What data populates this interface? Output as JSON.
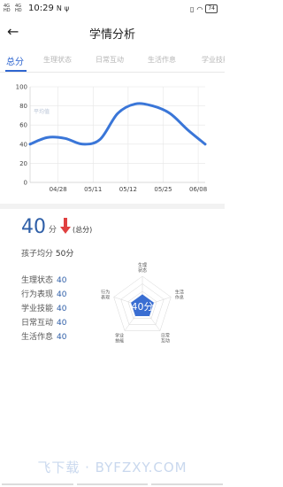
{
  "status_bar": {
    "signal_1": "4G HD",
    "signal_2": "4G HD",
    "time": "10:29",
    "app_icon": "N",
    "usb_icon": "usb-icon",
    "right_icons": [
      "vibrate-icon",
      "wifi-icon",
      "battery-icon"
    ],
    "battery": "74"
  },
  "header": {
    "back_icon": "arrow-left-icon",
    "title": "学情分析"
  },
  "tabs": [
    {
      "label": "总分",
      "active": true
    },
    {
      "label": "生理状态",
      "active": false
    },
    {
      "label": "日常互动",
      "active": false
    },
    {
      "label": "生活作息",
      "active": false
    },
    {
      "label": "学业技能",
      "active": false
    }
  ],
  "chart_data": {
    "type": "line",
    "title": "",
    "xlabel": "",
    "ylabel": "",
    "ylim": [
      0,
      100
    ],
    "yticks": [
      "0",
      "20",
      "40",
      "60",
      "80",
      "100"
    ],
    "xticks": [
      "04/28",
      "05/11",
      "05/12",
      "05/25",
      "06/08"
    ],
    "grid": true,
    "color": "#3a76d8",
    "series": [
      {
        "values": [
          40,
          47,
          46,
          40,
          45,
          72,
          82,
          80,
          72,
          55,
          40
        ]
      }
    ],
    "annotation": "平均值"
  },
  "summary": {
    "score": "40",
    "unit": "分",
    "trend_icon": "arrow-down-icon",
    "trend_color": "#e04040",
    "note": "(总分)",
    "avg_label": "孩子均分",
    "avg_value": "50分"
  },
  "dimensions": [
    {
      "label": "生理状态",
      "value": "40"
    },
    {
      "label": "行为表现",
      "value": "40"
    },
    {
      "label": "学业技能",
      "value": "40"
    },
    {
      "label": "日常互动",
      "value": "40"
    },
    {
      "label": "生活作息",
      "value": "40"
    }
  ],
  "radar": {
    "center_text": "40分",
    "axes": [
      "生理状态",
      "生活作息",
      "日常互动",
      "学业技能",
      "行为表现"
    ],
    "values": [
      40,
      40,
      40,
      40,
      40
    ],
    "max": 100,
    "fill_color": "#2f66d0"
  },
  "watermark": "飞下载 · BYFZXY.COM"
}
